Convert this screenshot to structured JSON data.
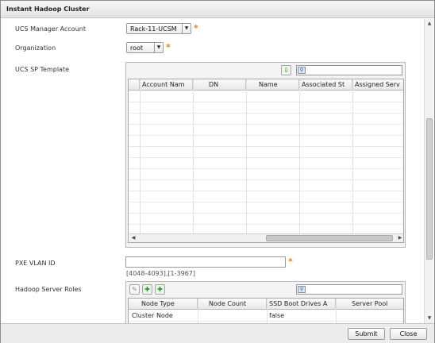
{
  "window": {
    "title": "Instant Hadoop Cluster"
  },
  "form": {
    "ucs_manager_account": {
      "label": "UCS Manager Account",
      "value": "Rack-11-UCSM"
    },
    "organization": {
      "label": "Organization",
      "value": "root"
    },
    "ucs_sp_template": {
      "label": "UCS SP Template",
      "columns": [
        "Account Nam",
        "DN",
        "Name",
        "Associated St",
        "Assigned Serv"
      ]
    },
    "pxe_vlan_id": {
      "label": "PXE VLAN ID",
      "value": "",
      "hint": "[4048-4093],[1-3967]"
    },
    "hadoop_server_roles": {
      "label": "Hadoop Server Roles",
      "columns": [
        "Node Type",
        "Node Count",
        "SSD Boot Drives A",
        "Server Pool"
      ],
      "rows": [
        {
          "node_type": "Cluster Node",
          "node_count": "",
          "ssd": "false",
          "pool": ""
        }
      ]
    },
    "required_marker": "*"
  },
  "footer": {
    "submit_label": "Submit",
    "close_label": "Close"
  },
  "icons": {
    "export": "export-icon",
    "search": "search-icon",
    "edit": "edit-icon",
    "add": "add-icon",
    "add_alt": "add-row-icon"
  },
  "colors": {
    "required": "#f07d1a",
    "accent": "#2c4e82"
  }
}
